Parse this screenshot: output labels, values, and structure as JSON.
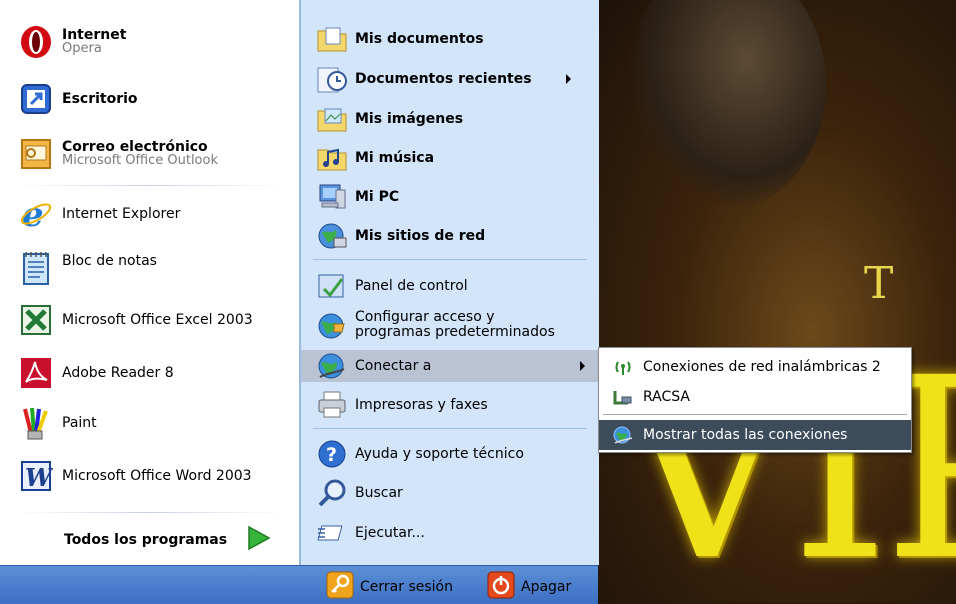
{
  "pinned": [
    {
      "name": "Internet",
      "sub": "Opera",
      "icon": "opera-icon"
    },
    {
      "name": "Escritorio",
      "icon": "desktop-shortcut-icon"
    },
    {
      "name": "Correo electrónico",
      "sub": "Microsoft Office Outlook",
      "icon": "outlook-icon"
    }
  ],
  "recent": [
    {
      "name": "Internet Explorer",
      "icon": "internet-explorer-icon"
    },
    {
      "name": "Bloc de notas",
      "icon": "notepad-icon"
    },
    {
      "name": "Microsoft Office Excel 2003",
      "icon": "excel-icon"
    },
    {
      "name": "Adobe Reader 8",
      "icon": "adobe-reader-icon"
    },
    {
      "name": "Paint",
      "icon": "paint-icon"
    },
    {
      "name": "Microsoft Office Word 2003",
      "icon": "word-icon"
    }
  ],
  "all_programs": "Todos los programas",
  "right": {
    "mis_documentos": "Mis documentos",
    "documentos_recientes": "Documentos recientes",
    "mis_imagenes": "Mis imágenes",
    "mi_musica": "Mi música",
    "mi_pc": "Mi PC",
    "mis_sitios_de_red": "Mis sitios de red",
    "panel_de_control": "Panel de control",
    "configurar_1": "Configurar acceso y",
    "configurar_2": "programas predeterminados",
    "conectar_a": "Conectar a",
    "impresoras": "Impresoras y faxes",
    "ayuda": "Ayuda y soporte técnico",
    "buscar": "Buscar",
    "ejecutar": "Ejecutar..."
  },
  "submenu": [
    {
      "label": "Conexiones de red inalámbricas 2",
      "icon": "wireless-network-icon"
    },
    {
      "label": "RACSA",
      "icon": "dialup-connection-icon"
    },
    {
      "label": "Mostrar todas las conexiones",
      "icon": "network-connections-icon"
    }
  ],
  "bottom": {
    "logoff": "Cerrar sesión",
    "shutdown": "Apagar"
  },
  "wallpaper": {
    "letter": "T",
    "word": "VIP"
  },
  "colors": {
    "right_pane": "#d3e5fa",
    "bottom_bar": "#3d6fc2",
    "submenu_highlight": "#3c4c5a",
    "wallpaper_text": "#f0e218"
  }
}
